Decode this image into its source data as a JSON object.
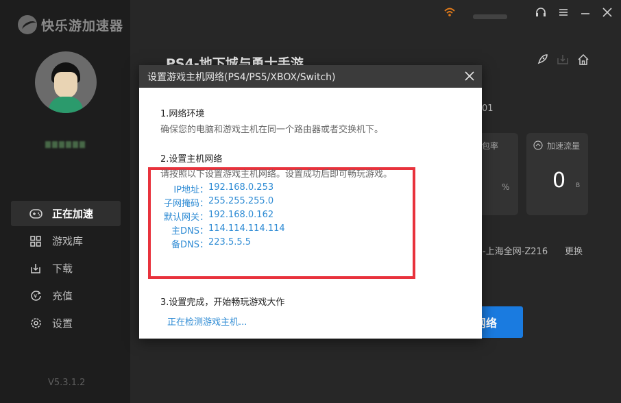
{
  "app": {
    "name": "快乐游加速器",
    "version": "V5.3.1.2"
  },
  "sidebar": {
    "username": "",
    "nav": [
      {
        "label": "正在加速",
        "icon": "gamepad-icon",
        "active": true
      },
      {
        "label": "游戏库",
        "icon": "grid-icon",
        "active": false
      },
      {
        "label": "下载",
        "icon": "download-icon",
        "active": false
      },
      {
        "label": "充值",
        "icon": "recharge-icon",
        "active": false
      },
      {
        "label": "设置",
        "icon": "gear-icon",
        "active": false
      }
    ]
  },
  "main": {
    "game_title": "PS4-地下城与勇士手游",
    "partial_number": "01",
    "cards": [
      {
        "label": "包率",
        "value": "",
        "unit": "%"
      },
      {
        "label": "加速流量",
        "value": "0",
        "unit": "B"
      }
    ],
    "server": "-上海全网-Z216",
    "change_label": "更换",
    "network_button": "网络"
  },
  "modal": {
    "title": "设置游戏主机网络(PS4/PS5/XBOX/Switch)",
    "step1": {
      "title": "1.网络环境",
      "desc": "确保您的电脑和游戏主机在同一个路由器或者交换机下。"
    },
    "step2": {
      "title": "2.设置主机网络",
      "desc": "请按照以下设置游戏主机网络。设置成功后即可畅玩游戏。",
      "settings": [
        {
          "key": "IP地址：",
          "value": "192.168.0.253"
        },
        {
          "key": "子网掩码：",
          "value": "255.255.255.0"
        },
        {
          "key": "默认网关：",
          "value": "192.168.0.162"
        },
        {
          "key": "主DNS：",
          "value": "114.114.114.114"
        },
        {
          "key": "备DNS：",
          "value": "223.5.5.5"
        }
      ]
    },
    "step3": {
      "title": "3.设置完成，开始畅玩游戏大作",
      "status": "正在检测游戏主机..."
    }
  },
  "colors": {
    "accent": "#1a7be0",
    "highlight_border": "#e8323c",
    "link": "#2e8bd4"
  }
}
